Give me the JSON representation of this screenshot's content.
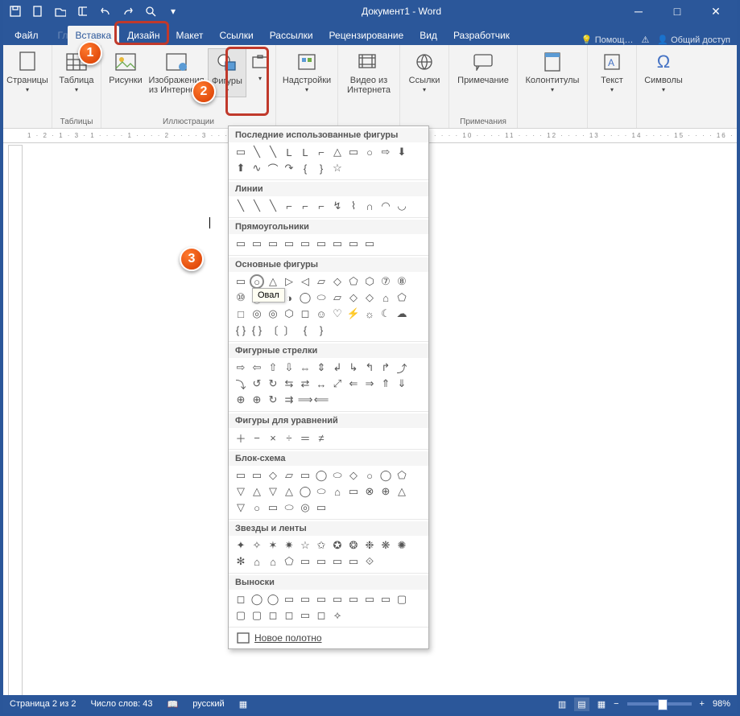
{
  "app_title": "Документ1 - Word",
  "tabs": {
    "file": "Файл",
    "home": "Главная",
    "insert": "Вставка",
    "design": "Дизайн",
    "layout": "Макет",
    "references": "Ссылки",
    "mailings": "Рассылки",
    "review": "Рецензирование",
    "view": "Вид",
    "developer": "Разработчик",
    "tellme": "Помощ…",
    "share": "Общий доступ"
  },
  "ribbon": {
    "pages": {
      "btn": "Страницы",
      "label": ""
    },
    "tables": {
      "btn": "Таблица",
      "label": "Таблицы"
    },
    "illustr": {
      "pictures": "Рисунки",
      "online": "Изображения из Интернета",
      "shapes": "Фигуры",
      "label": "Иллюстрации"
    },
    "addins": "Надстройки",
    "video": "Видео из Интернета",
    "links": "Ссылки",
    "comment": "Примечание",
    "comments_label": "Примечания",
    "headerfooter": "Колонтитулы",
    "text": "Текст",
    "symbols": "Символы"
  },
  "shapes_menu": {
    "recent": "Последние использованные фигуры",
    "lines": "Линии",
    "rects": "Прямоугольники",
    "basic": "Основные фигуры",
    "arrows": "Фигурные стрелки",
    "equation": "Фигуры для уравнений",
    "flowchart": "Блок-схема",
    "stars": "Звезды и ленты",
    "callouts": "Выноски",
    "new_canvas": "Новое полотно"
  },
  "tooltip": "Овал",
  "status": {
    "page": "Страница 2 из 2",
    "words": "Число слов: 43",
    "lang": "русский",
    "zoom": "98%"
  },
  "ruler_h": "1 · 2 · 1 · 3 · 1 · · · · 1 · · · · 2 · · · · 3 · · · · 4 · · · · 5 · · · · 6 · · · · 7 · · · · 8 · · · · 9 · · · · 10 · · · · 11 · · · · 12 · · · · 13 · · · · 14 · · · · 15 · · · · 16 · · · · 17 · ·"
}
